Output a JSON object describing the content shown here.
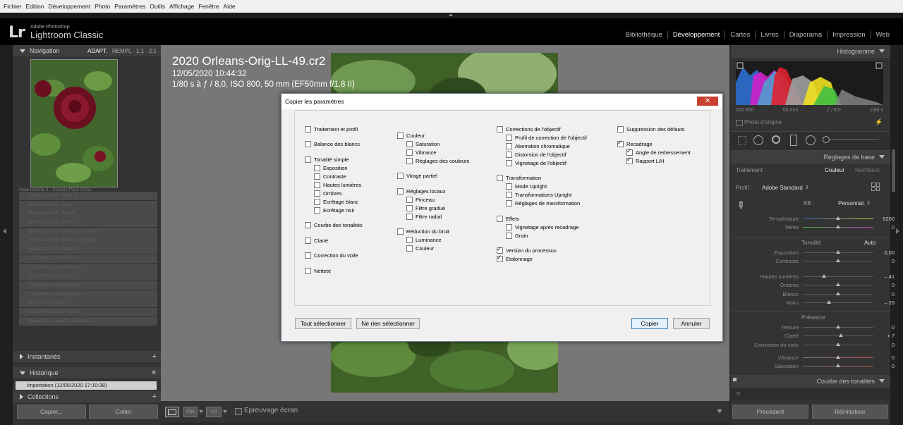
{
  "menu": [
    "Fichier",
    "Edition",
    "Développement",
    "Photo",
    "Paramètres",
    "Outils",
    "Affichage",
    "Fenêtre",
    "Aide"
  ],
  "app": {
    "logo": "Lr",
    "vendor": "Adobe Photoshop",
    "name": "Lightroom Classic"
  },
  "modules": [
    "Bibliothèque",
    "Développement",
    "Cartes",
    "Livres",
    "Diaporama",
    "Impression",
    "Web"
  ],
  "left": {
    "navigation": {
      "title": "Navigation",
      "options": [
        "ADAPT.",
        "REMPL",
        "1:1",
        "2:1"
      ]
    },
    "presets_header": "Réplicatione II - Sample Pack Films",
    "presets": [
      "Réplicatione II - Fadé 01",
      "Réplicatione II - Agfa",
      "Réplicatione II - Kodak",
      "Réplicatione II - Cibles",
      "Réplicatione II - Version Noir Film",
      "Réplicatione II - Black and White",
      "Réplicatione II - Fadé 02",
      "2022 FHC Color Presets",
      "2022 FHC Night Pourpets",
      "2022 FHC Noir et Pan",
      "2022 FHC Standard B&W",
      "2022 FHC Standard Color",
      "2022 FHC Tuesth",
      "2022 FHC Tutshi - Color",
      "Réplicatione palette de couleurs"
    ],
    "snapshots": "Instantanés",
    "history": "Historique",
    "history_item": "Importation (12/05/2020 17:10:38)",
    "collections": "Collections",
    "copy_button": "Copier...",
    "paste_button": "Coller"
  },
  "photo": {
    "filename": "2020 Orleans-Orig-LL-49.cr2",
    "datetime": "12/05/2020 10:44:32",
    "exposure": "1/80 s à ƒ / 8,0, ISO 800, 50 mm (EF50mm f/1.8 II)"
  },
  "toolbar": {
    "softproof": "Epreuvage écran"
  },
  "right": {
    "histogram_title": "Histogramme",
    "hist_info": [
      "ISO 800",
      "50 mm",
      "ƒ / 8,0",
      "1/80 s"
    ],
    "original_photo": "Photo d'origine",
    "basic_title": "Réglages de base",
    "treatment_label": "Traitement :",
    "treatment_color": "Couleur",
    "treatment_bw": "Noir/blanc",
    "profile_label": "Profil :",
    "profile_value": "Adobe Standard",
    "wb_label": "BB :",
    "wb_value": "Personnal.",
    "temp_sliders": [
      {
        "label": "Température",
        "value": "5200",
        "pos": 0.5
      },
      {
        "label": "Teinte",
        "value": "0",
        "pos": 0.5
      }
    ],
    "tone_label": "Tonalité",
    "tone_auto": "Auto",
    "tone_sliders": [
      {
        "label": "Exposition",
        "value": "0,00",
        "pos": 0.5
      },
      {
        "label": "Contraste",
        "value": "0",
        "pos": 0.5
      }
    ],
    "light_sliders": [
      {
        "label": "Hautes lumières",
        "value": "– 41",
        "pos": 0.3
      },
      {
        "label": "Ombres",
        "value": "0",
        "pos": 0.5
      },
      {
        "label": "Blancs",
        "value": "0",
        "pos": 0.5
      },
      {
        "label": "Noirs",
        "value": "– 26",
        "pos": 0.37
      }
    ],
    "presence_label": "Présence",
    "presence_sliders": [
      {
        "label": "Texture",
        "value": "0",
        "pos": 0.5
      },
      {
        "label": "Clarté",
        "value": "+ 7",
        "pos": 0.54
      },
      {
        "label": "Correction du voile",
        "value": "0",
        "pos": 0.5
      }
    ],
    "vib_sliders": [
      {
        "label": "Vibrance",
        "value": "0",
        "pos": 0.5
      },
      {
        "label": "Saturation",
        "value": "0",
        "pos": 0.5
      }
    ],
    "curve_title": "Courbe des tonalités",
    "prev_button": "Précédent",
    "reset_button": "Réinitialiser"
  },
  "dialog": {
    "title": "Copier les paramètres",
    "close": "✕",
    "columns": [
      [
        {
          "label": "Traitement et profil",
          "checked": false,
          "indent": 0,
          "gap": 0
        },
        {
          "label": "Balance des blancs",
          "checked": false,
          "indent": 0,
          "gap": 1
        },
        {
          "label": "Tonalité simple",
          "checked": false,
          "indent": 0,
          "gap": 1
        },
        {
          "label": "Exposition",
          "checked": false,
          "indent": 1,
          "gap": 0
        },
        {
          "label": "Contraste",
          "checked": false,
          "indent": 1,
          "gap": 0
        },
        {
          "label": "Hautes lumières",
          "checked": false,
          "indent": 1,
          "gap": 0
        },
        {
          "label": "Ombres",
          "checked": false,
          "indent": 1,
          "gap": 0
        },
        {
          "label": "Ecrêtage blanc",
          "checked": false,
          "indent": 1,
          "gap": 0
        },
        {
          "label": "Ecrêtage noir",
          "checked": false,
          "indent": 1,
          "gap": 0
        },
        {
          "label": "Courbe des tonalités",
          "checked": false,
          "indent": 0,
          "gap": 1
        },
        {
          "label": "Clarté",
          "checked": false,
          "indent": 0,
          "gap": 1
        },
        {
          "label": "Correction du voile",
          "checked": false,
          "indent": 0,
          "gap": 1
        },
        {
          "label": "Netteté",
          "checked": false,
          "indent": 0,
          "gap": 1
        }
      ],
      [
        {
          "label": "Couleur",
          "checked": false,
          "indent": 0,
          "gap": 0
        },
        {
          "label": "Saturation",
          "checked": false,
          "indent": 1,
          "gap": 0
        },
        {
          "label": "Vibrance",
          "checked": false,
          "indent": 1,
          "gap": 0
        },
        {
          "label": "Réglages des couleurs",
          "checked": false,
          "indent": 1,
          "gap": 0
        },
        {
          "label": "Virage partiel",
          "checked": false,
          "indent": 0,
          "gap": 1
        },
        {
          "label": "Réglages locaux",
          "checked": false,
          "indent": 0,
          "gap": 1
        },
        {
          "label": "Pinceau",
          "checked": false,
          "indent": 1,
          "gap": 0
        },
        {
          "label": "Filtre gradué",
          "checked": false,
          "indent": 1,
          "gap": 0
        },
        {
          "label": "Filtre radial",
          "checked": false,
          "indent": 1,
          "gap": 0
        },
        {
          "label": "Réduction du bruit",
          "checked": false,
          "indent": 0,
          "gap": 1
        },
        {
          "label": "Luminance",
          "checked": false,
          "indent": 1,
          "gap": 0
        },
        {
          "label": "Couleur",
          "checked": false,
          "indent": 1,
          "gap": 0
        }
      ],
      [
        {
          "label": "Corrections de l'objectif",
          "checked": false,
          "indent": 0,
          "gap": 0
        },
        {
          "label": "Profil de correction de l'objectif",
          "checked": false,
          "indent": 1,
          "gap": 0
        },
        {
          "label": "Aberration chromatique",
          "checked": false,
          "indent": 1,
          "gap": 0
        },
        {
          "label": "Distorsion de l'objectif",
          "checked": false,
          "indent": 1,
          "gap": 0
        },
        {
          "label": "Vignetage de l'objectif",
          "checked": false,
          "indent": 1,
          "gap": 0
        },
        {
          "label": "Transformation",
          "checked": false,
          "indent": 0,
          "gap": 1
        },
        {
          "label": "Mode Upright",
          "checked": false,
          "indent": 1,
          "gap": 0
        },
        {
          "label": "Transformations Upright",
          "checked": false,
          "indent": 1,
          "gap": 0
        },
        {
          "label": "Réglages de transformation",
          "checked": false,
          "indent": 1,
          "gap": 0
        },
        {
          "label": "Effets",
          "checked": false,
          "indent": 0,
          "gap": 1
        },
        {
          "label": "Vignetage après recadrage",
          "checked": false,
          "indent": 1,
          "gap": 0
        },
        {
          "label": "Grain",
          "checked": false,
          "indent": 1,
          "gap": 0
        },
        {
          "label": "Version du processus",
          "checked": true,
          "indent": 0,
          "gap": 1
        },
        {
          "label": "Etalonnage",
          "checked": true,
          "indent": 0,
          "gap": 0
        }
      ],
      [
        {
          "label": "Suppression des défauts",
          "checked": false,
          "indent": 0,
          "gap": 0
        },
        {
          "label": "Recadrage",
          "checked": true,
          "indent": 0,
          "gap": 1
        },
        {
          "label": "Angle de redressement",
          "checked": true,
          "indent": 1,
          "gap": 0
        },
        {
          "label": "Rapport L/H",
          "checked": true,
          "indent": 1,
          "gap": 0
        }
      ]
    ],
    "select_all": "Tout sélectionner",
    "select_none": "Ne rien sélectionner",
    "copy": "Copier",
    "cancel": "Annuler"
  }
}
